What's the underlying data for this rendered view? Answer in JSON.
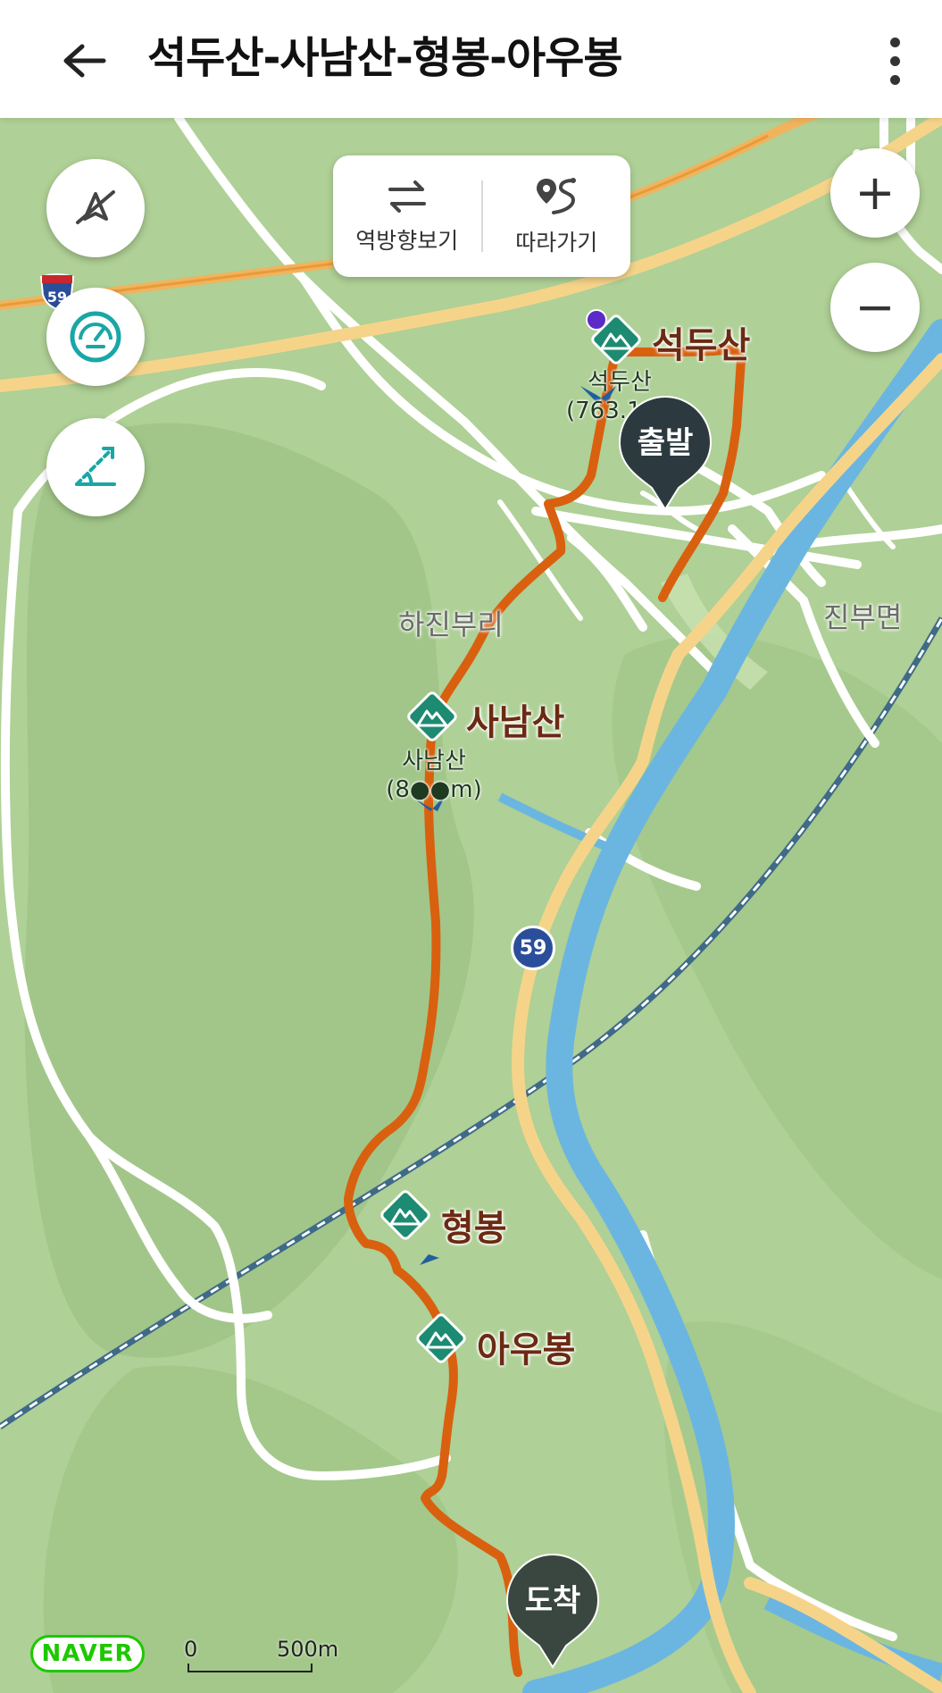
{
  "header": {
    "back_icon": "arrow-left-icon",
    "title": "석두산-사남산-형봉-아우봉",
    "more_icon": "more-vertical-icon"
  },
  "toolbar": {
    "reverse_label": "역방향보기",
    "reverse_icon": "swap-arrows-icon",
    "follow_label": "따라가기",
    "follow_icon": "route-follow-icon"
  },
  "map_controls": {
    "compass_icon": "compass-off-icon",
    "speed_icon": "speedometer-icon",
    "elevation_icon": "slope-icon",
    "zoom_in_label": "+",
    "zoom_out_label": "−"
  },
  "map": {
    "road_badge_number": "59",
    "interstate_badge_number": "59",
    "area_labels": {
      "hajinburi": "하진부리",
      "jinbumyeon": "진부면"
    },
    "peaks": {
      "seokdusan": {
        "label": "석두산",
        "sub_name": "석두산",
        "sub_elevation": "(763.1m)"
      },
      "sanamsan": {
        "label": "사남산",
        "sub_name": "사남산",
        "sub_elevation": "(8●●m)"
      },
      "hyeongbong": {
        "label": "형봉"
      },
      "aubong": {
        "label": "아우봉"
      }
    },
    "start_label": "출발",
    "end_label": "도착",
    "colors": {
      "route": "#d9600f",
      "river": "#6bb6e0",
      "road_major": "#f5d48a",
      "peak_icon": "#1d8a72",
      "pin": "#2c3a3f"
    }
  },
  "footer": {
    "logo": "NAVER",
    "scale_zero": "0",
    "scale_distance": "500m"
  }
}
